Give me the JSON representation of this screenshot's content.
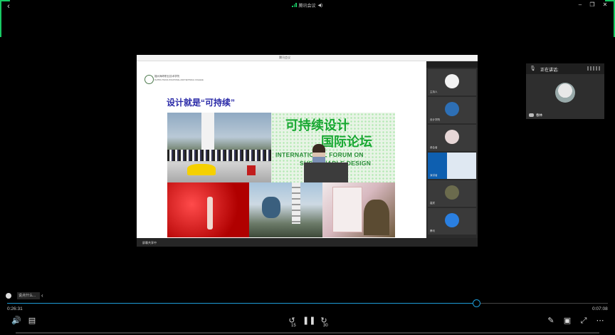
{
  "window": {
    "title": "腾讯会议",
    "colors": {
      "accent": "#18c964",
      "progress": "#1e9ad6",
      "heading": "#2a2aa8",
      "forum_green": "#18a832"
    }
  },
  "slide": {
    "school_name": "福州海峡职业技术学院",
    "school_subtitle": "FUZHOU HAIXIA VOCATIONAL AND TECHNICAL COLLEGE",
    "heading": "设计就是“可持续”",
    "forum_title_line1": "可持续设计",
    "forum_title_line2": "国际论坛",
    "forum_en_line1": "INTERNATIONAL FORUM ON",
    "forum_en_line2": "SUSTAINABLE DESIGN"
  },
  "participants": [
    {
      "label": "主持人",
      "icon": "avatar-icon"
    },
    {
      "label": "设计学院",
      "icon": "avatar-icon"
    },
    {
      "label": "参会者",
      "icon": "avatar-icon"
    },
    {
      "label": "演讲者",
      "icon": "video-icon"
    },
    {
      "label": "嘉宾",
      "icon": "avatar-icon"
    },
    {
      "label": "腾讯",
      "icon": "avatar-icon"
    }
  ],
  "share_footer": "屏幕共享中",
  "speaker": {
    "title": "正在讲话:",
    "name": "春林"
  },
  "comment": {
    "placeholder": "说点什么..."
  },
  "player": {
    "current_time": "0:26:31",
    "total_time": "0:07:08",
    "progress_fraction": 0.781,
    "rewind_label": "15",
    "forward_label": "30"
  }
}
